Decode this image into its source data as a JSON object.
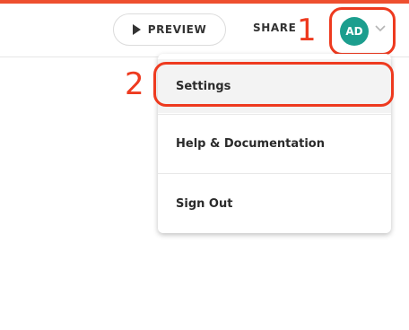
{
  "header": {
    "preview_label": "PREVIEW",
    "share_label": "SHARE",
    "avatar_initials": "AD"
  },
  "annotations": {
    "step_1": "1",
    "step_2": "2"
  },
  "user_menu": {
    "items": [
      {
        "label": "Settings",
        "highlighted": true
      },
      {
        "label": "Help & Documentation"
      },
      {
        "label": "Sign Out"
      }
    ]
  },
  "icons": {
    "preview": "play-icon",
    "avatar_menu": "chevron-down-icon"
  },
  "colors": {
    "accent": "#ee4f2f",
    "annotation": "#ee3a1f",
    "avatar": "#1c9e8e"
  }
}
